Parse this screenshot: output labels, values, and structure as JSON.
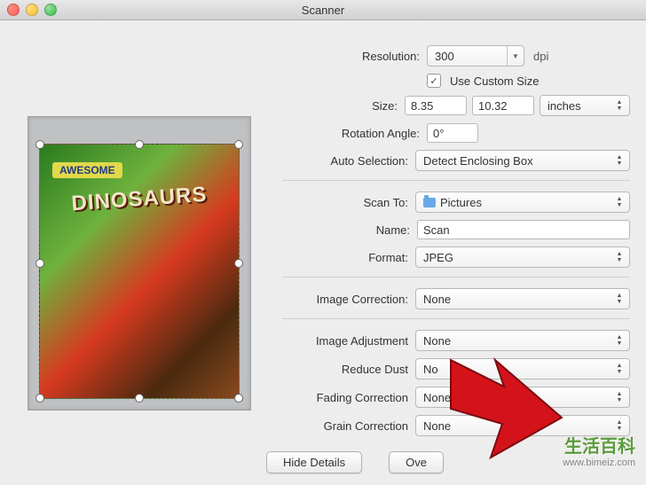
{
  "window": {
    "title": "Scanner"
  },
  "preview": {
    "cover_badge": "AWESOME",
    "cover_title": "DINOSAURS"
  },
  "settings": {
    "resolution_label": "Resolution:",
    "resolution_value": "300",
    "resolution_unit": "dpi",
    "custom_size_label": "Use Custom Size",
    "size_label": "Size:",
    "size_w": "8.35",
    "size_h": "10.32",
    "size_unit": "inches",
    "rotation_label": "Rotation Angle:",
    "rotation_value": "0°",
    "auto_sel_label": "Auto Selection:",
    "auto_sel_value": "Detect Enclosing Box",
    "scan_to_label": "Scan To:",
    "scan_to_value": "Pictures",
    "name_label": "Name:",
    "name_value": "Scan",
    "format_label": "Format:",
    "format_value": "JPEG",
    "img_corr_label": "Image Correction:",
    "img_corr_value": "None",
    "img_adj_label": "Image Adjustment",
    "img_adj_value": "None",
    "dust_label": "Reduce Dust",
    "dust_value": "No",
    "fade_label": "Fading Correction",
    "fade_value": "None",
    "grain_label": "Grain Correction",
    "grain_value": "None"
  },
  "buttons": {
    "hide_details": "Hide Details",
    "overview": "Ove"
  },
  "watermark": {
    "cn": "生活百科",
    "url": "www.bimeiz.com"
  }
}
